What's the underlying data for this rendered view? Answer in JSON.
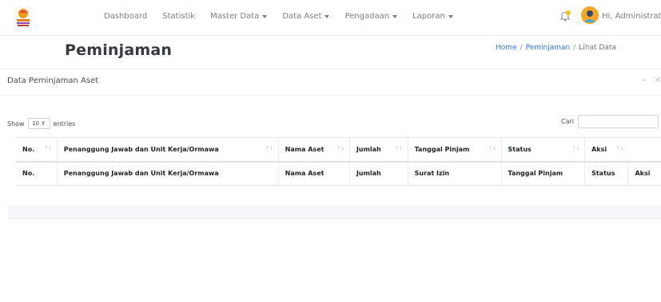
{
  "navbar": {
    "items": [
      {
        "label": "Dashboard",
        "dropdown": false
      },
      {
        "label": "Statistik",
        "dropdown": false
      },
      {
        "label": "Master Data",
        "dropdown": true
      },
      {
        "label": "Data Aset",
        "dropdown": true
      },
      {
        "label": "Pengadaan",
        "dropdown": true
      },
      {
        "label": "Laporan",
        "dropdown": true
      }
    ],
    "user_greeting": "Hi, Administrator",
    "notification_icon": "bell-icon",
    "avatar_icon": "user-avatar-icon"
  },
  "page": {
    "title": "Peminjaman",
    "breadcrumb": [
      "Home",
      "Peminjaman",
      "Lihat Data"
    ]
  },
  "card": {
    "title": "Data Peminjaman Aset",
    "tools": [
      "minimize-icon",
      "close-icon"
    ]
  },
  "datatable": {
    "show_label": "Show",
    "entries_value": "10",
    "entries_label": "entries",
    "search_label": "Cari",
    "header": [
      "No.",
      "Penanggung Jawab dan Unit Kerja/Ormawa",
      "Nama Aset",
      "Jumlah",
      "Tanggal Pinjam",
      "Status",
      "Aksi"
    ],
    "footer": [
      "No.",
      "Penanggung Jawab dan Unit Kerja/Ormawa",
      "Nama Aset",
      "Jumlah",
      "Surat Izin",
      "Tanggal Pinjam",
      "Status",
      "Aksi"
    ],
    "sort_icon": "↑↓"
  },
  "colors": {
    "link": "#2c7be5",
    "text": "#495057",
    "muted": "#7a8188",
    "avatar": "#f5a623"
  }
}
